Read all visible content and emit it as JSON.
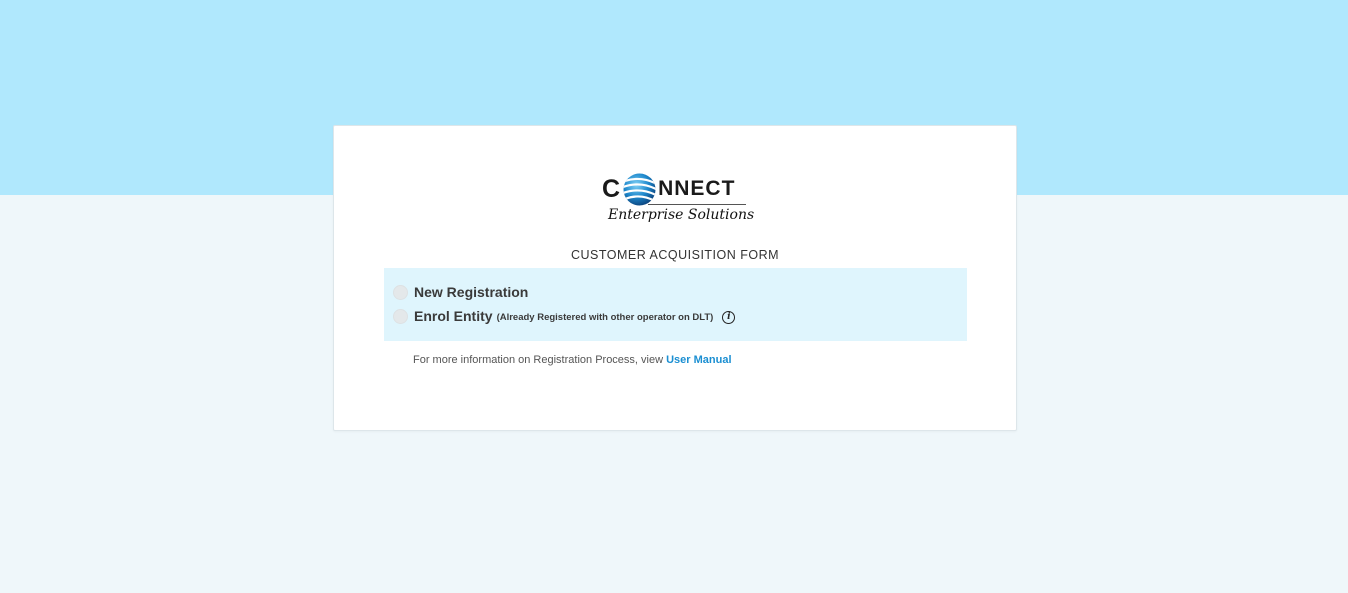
{
  "brand": {
    "logo_first_letter": "C",
    "logo_rest": "NNECT",
    "logo_tagline": "Enterprise Solutions",
    "logo_icon": "globe-icon",
    "accent_color": "#1b8fd2",
    "header_band_color": "#b0e8fd"
  },
  "form": {
    "title": "CUSTOMER ACQUISITION FORM",
    "options": [
      {
        "label": "New Registration",
        "note": "",
        "selected": false
      },
      {
        "label": "Enrol Entity",
        "note": "(Already Registered with other operator on DLT)",
        "selected": false,
        "icon": "info-icon"
      }
    ],
    "info_icon_glyph": "i",
    "more_info_text": "For more information on Registration Process, view",
    "manual_link": "User Manual"
  }
}
